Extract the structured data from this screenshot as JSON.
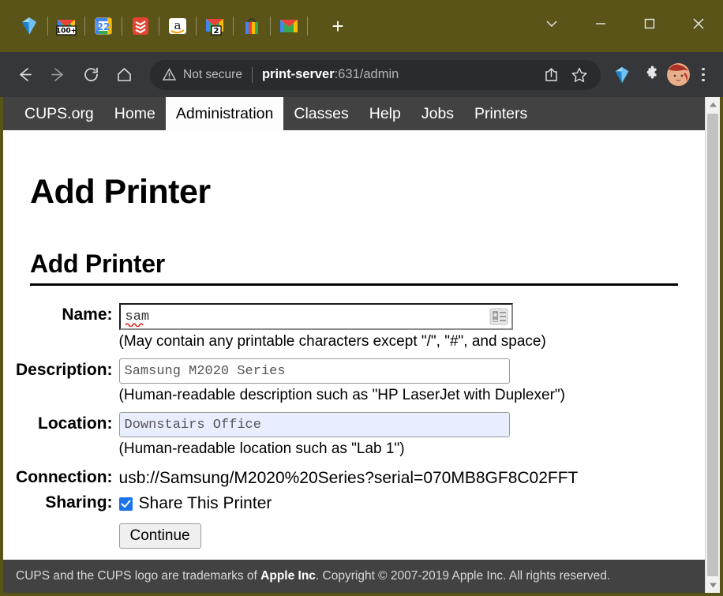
{
  "browser": {
    "tabs": [
      {
        "name": "tab-favicon-gem",
        "icon": "gem-icon"
      },
      {
        "name": "tab-favicon-gmail-100",
        "icon": "gmail-badge-icon",
        "badge": "100+"
      },
      {
        "name": "tab-favicon-calendar",
        "icon": "calendar-icon",
        "badge": "22"
      },
      {
        "name": "tab-favicon-todoist",
        "icon": "todoist-icon"
      },
      {
        "name": "tab-favicon-amazon",
        "icon": "amazon-icon"
      },
      {
        "name": "tab-favicon-gmail-2",
        "icon": "gmail-badge-icon",
        "badge": "2"
      },
      {
        "name": "tab-favicon-shopping",
        "icon": "shopping-bag-icon"
      },
      {
        "name": "tab-favicon-gmail",
        "icon": "gmail-icon"
      }
    ],
    "new_tab_label": "+",
    "window_controls": {
      "tab_search": "tab-search-icon",
      "minimize": "minimize-icon",
      "maximize": "maximize-icon",
      "close": "close-icon"
    },
    "nav": {
      "back": "back-arrow-icon",
      "forward": "forward-arrow-icon",
      "reload": "reload-icon",
      "home": "home-icon"
    },
    "omnibox": {
      "security_label": "Not secure",
      "security_icon": "warning-triangle-icon",
      "url_host": "print-server",
      "url_rest": ":631/admin",
      "share_icon": "share-icon",
      "bookmark_icon": "star-icon"
    },
    "toolbar_extensions": {
      "gem": "gem-extension-icon",
      "puzzle": "puzzle-piece-icon",
      "profile": "profile-avatar",
      "menu": "three-dot-menu-icon"
    },
    "titlebar_color": "#5a5419",
    "toolbar_color": "#35373a"
  },
  "cups": {
    "nav": [
      {
        "label": "CUPS.org",
        "active": false
      },
      {
        "label": "Home",
        "active": false
      },
      {
        "label": "Administration",
        "active": true
      },
      {
        "label": "Classes",
        "active": false
      },
      {
        "label": "Help",
        "active": false
      },
      {
        "label": "Jobs",
        "active": false
      },
      {
        "label": "Printers",
        "active": false
      }
    ],
    "page_title": "Add Printer",
    "section_title": "Add Printer",
    "form": {
      "name": {
        "label": "Name:",
        "value": "sam",
        "hint": "(May contain any printable characters except \"/\", \"#\", and space)",
        "autofill_icon": "contact-card-icon"
      },
      "description": {
        "label": "Description:",
        "value": "Samsung M2020 Series",
        "hint": "(Human-readable description such as \"HP LaserJet with Duplexer\")"
      },
      "location": {
        "label": "Location:",
        "value": "Downstairs Office",
        "hint": "(Human-readable location such as \"Lab 1\")"
      },
      "connection": {
        "label": "Connection:",
        "value": "usb://Samsung/M2020%20Series?serial=070MB8GF8C02FFT"
      },
      "sharing": {
        "label": "Sharing:",
        "checkbox_label": "Share This Printer",
        "checked": true
      },
      "submit_label": "Continue"
    },
    "footer": {
      "text_before": "CUPS and the CUPS logo are trademarks of ",
      "brand": "Apple Inc",
      "text_after": ". Copyright © 2007-2019 Apple Inc. All rights reserved."
    },
    "accent_checkbox_color": "#1a73e8",
    "nav_bar_color": "#424242"
  }
}
